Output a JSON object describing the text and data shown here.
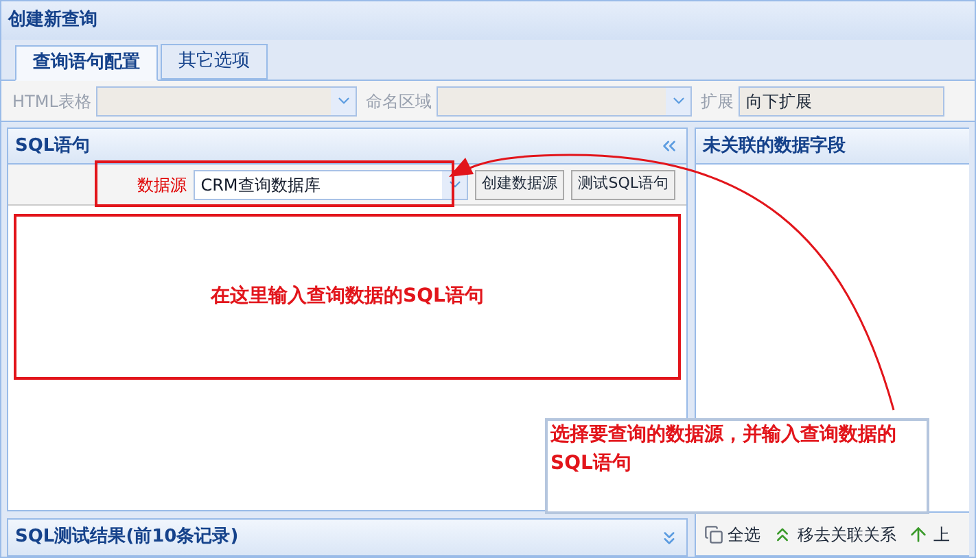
{
  "window": {
    "title": "创建新查询"
  },
  "tabs": [
    {
      "label": "查询语句配置",
      "selected": true
    },
    {
      "label": "其它选项",
      "selected": false
    }
  ],
  "form": {
    "html_table": {
      "label": "HTML表格",
      "disabled": true
    },
    "named_range": {
      "label": "命名区域",
      "disabled": true
    },
    "expand": {
      "label": "扩展",
      "value": "向下扩展",
      "disabled": true
    }
  },
  "sql_panel": {
    "title": "SQL语句",
    "data_source": {
      "label": "数据源",
      "value": "CRM查询数据库"
    },
    "buttons": [
      "创建数据源",
      "测试SQL语句"
    ]
  },
  "results_panel": {
    "title": "SQL测试结果(前10条记录)"
  },
  "fields_panel": {
    "title": "未关联的数据字段",
    "toolbar": [
      {
        "kind": "copy",
        "label": "全选"
      },
      {
        "kind": "chevrons",
        "label": "移去关联关系"
      },
      {
        "kind": "arrow",
        "label": "上"
      }
    ]
  },
  "annotations": {
    "editor_hint": "在这里输入查询数据的SQL语句",
    "callout": "选择要查询的数据源，并输入查询数据的SQL语句"
  }
}
